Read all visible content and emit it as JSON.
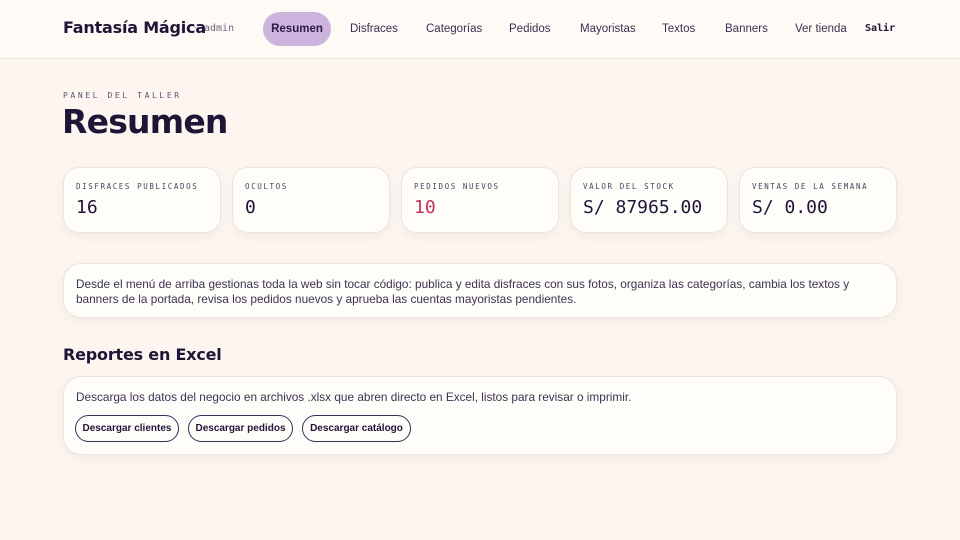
{
  "header": {
    "brand": "Fantasía Mágica",
    "separator": "·",
    "role": "admin",
    "nav": [
      {
        "label": "Resumen",
        "active": true
      },
      {
        "label": "Disfraces"
      },
      {
        "label": "Categorías"
      },
      {
        "label": "Pedidos"
      },
      {
        "label": "Mayoristas"
      },
      {
        "label": "Textos"
      },
      {
        "label": "Banners"
      },
      {
        "label": "Ver tienda"
      }
    ],
    "logout": "Salir"
  },
  "page": {
    "eyebrow": "PANEL DEL TALLER",
    "title": "Resumen"
  },
  "stats": [
    {
      "label": "DISFRACES PUBLICADOS",
      "value": "16"
    },
    {
      "label": "OCULTOS",
      "value": "0"
    },
    {
      "label": "PEDIDOS NUEVOS",
      "value": "10",
      "highlight": true
    },
    {
      "label": "VALOR DEL STOCK",
      "value": "S/ 87965.00"
    },
    {
      "label": "VENTAS DE LA SEMANA",
      "value": "S/ 0.00"
    }
  ],
  "intro": "Desde el menú de arriba gestionas toda la web sin tocar código: publica y edita disfraces con sus fotos, organiza las categorías, cambia los textos y banners de la portada, revisa los pedidos nuevos y aprueba las cuentas mayoristas pendientes.",
  "reports": {
    "title": "Reportes en Excel",
    "description": "Descarga los datos del negocio en archivos .xlsx que abren directo en Excel, listos para revisar o imprimir.",
    "buttons": [
      {
        "label": "Descargar clientes"
      },
      {
        "label": "Descargar pedidos"
      },
      {
        "label": "Descargar catálogo"
      }
    ]
  },
  "colors": {
    "background": "#fdf6f0",
    "nav_active": "#cdb4df",
    "text_dark": "#1e1537",
    "alert": "#c2335a"
  }
}
